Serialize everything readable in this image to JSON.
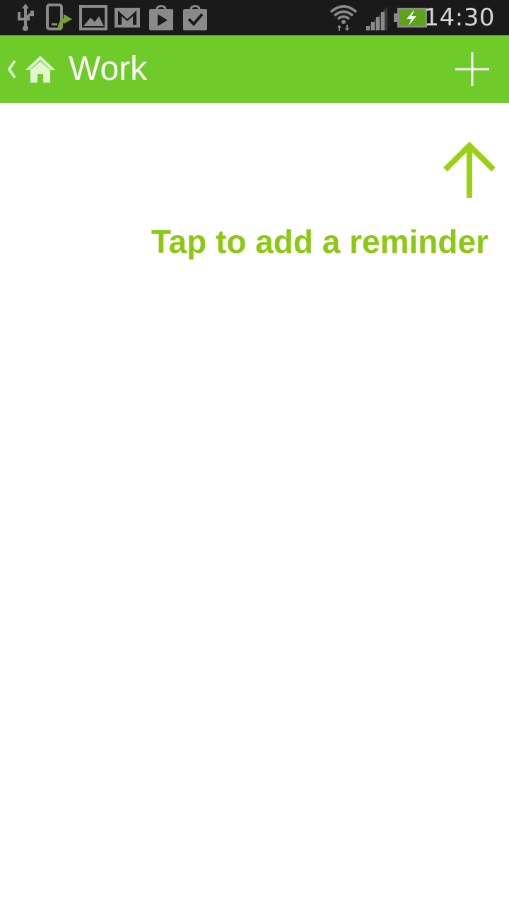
{
  "status_bar": {
    "time": "14:30",
    "icons": [
      "usb-icon",
      "phone-upload-icon",
      "gallery-icon",
      "gmail-icon",
      "play-store-icon",
      "shopping-bag-check-icon",
      "wifi-icon",
      "signal-icon",
      "battery-charging-icon"
    ]
  },
  "action_bar": {
    "title": "Work",
    "up_icon": "chevron-left-icon",
    "home_icon": "home-icon",
    "add_icon": "plus-icon",
    "color": "#6ecb2a"
  },
  "empty_state": {
    "hint_text": "Tap to add a reminder",
    "hint_icon": "arrow-up-icon",
    "hint_color": "#8cc814"
  }
}
